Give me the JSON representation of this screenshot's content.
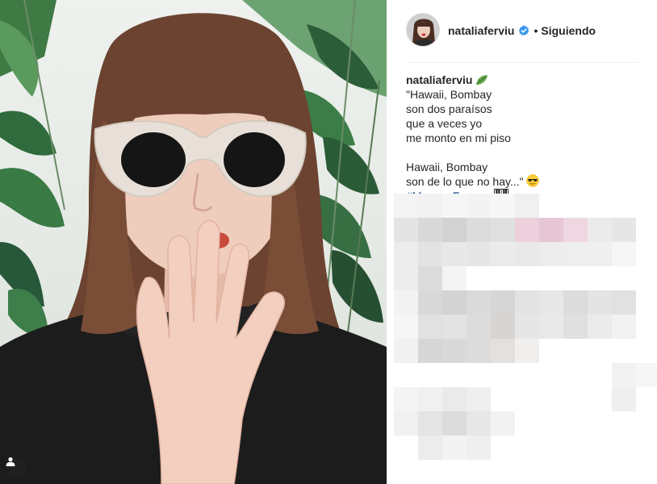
{
  "post": {
    "author": {
      "username": "nataliaferviu",
      "verified": true,
      "follow_status": "Siguiendo",
      "separator": "•"
    },
    "caption": {
      "username": "nataliaferviu",
      "leaf_emoji": "leaf-emoji",
      "lines": [
        "\"Hawaii, Bombay",
        "son dos paraísos",
        "que a veces yo",
        "me monto en mi piso",
        "",
        "Hawaii, Bombay",
        "son de lo que no hay...\""
      ],
      "hashtag": "#MecanoForever",
      "trailing_emojis": [
        "sunglasses-face-emoji",
        "piano-keys-emoji"
      ]
    },
    "photo": {
      "subject": "woman in white cat-eye sunglasses with hand over mouth in front of plants",
      "tag_badge_icon": "user-tag-icon"
    },
    "comments_area": {
      "state": "pixelated-blurred"
    }
  },
  "colors": {
    "text": "#262626",
    "hashtag": "#003569",
    "verified": "#3897f0",
    "divider": "#efefef",
    "sweater": "#1c1c1c",
    "hair": "#6b4330",
    "skin": "#efcdbd",
    "glasses_frame": "#e8e0d8",
    "leaf": "#2e5a3a"
  }
}
